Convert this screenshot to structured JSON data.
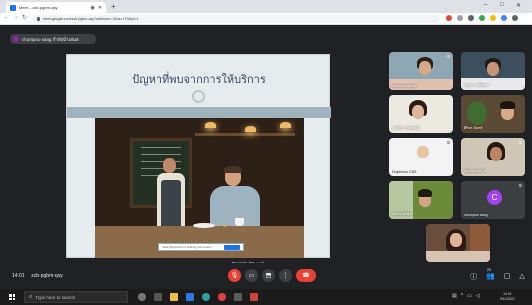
{
  "browser": {
    "tab_title": "Meet – zzb-pgbm-qsy",
    "url": "meet.google.com/zzb-pgbm-qsy?authuser=1&hs=179&pli=1"
  },
  "meet": {
    "presenting": "chompoo sang กำลังนำเสนอ",
    "slide_title": "ปัญหาที่พบจากการให้บริการ",
    "slide_caption": "Rentals (21 + s)",
    "present_pill_text": "meet.google.com is sharing your screen",
    "clock": "14:01",
    "meeting_code": "zzb-pgbm-qsy",
    "participant_count": "23"
  },
  "tiles": [
    {
      "name": "chompoo sang",
      "avatar_letter": ""
    },
    {
      "name": "ธนากร วงศ์ทอง",
      "avatar_letter": ""
    },
    {
      "name": "อาภิสรา รัตนพันธ์",
      "avatar_letter": ""
    },
    {
      "name": "ศิริพร จันทร์",
      "avatar_letter": ""
    },
    {
      "name": "Dolphinus CAS",
      "avatar_letter": ""
    },
    {
      "name": "ณัฐชนก สุขใจ",
      "avatar_letter": ""
    },
    {
      "name": "ปกรณ์ ศรีสุข",
      "avatar_letter": ""
    },
    {
      "name": "chompoo sang",
      "avatar_letter": "C"
    },
    {
      "name": "",
      "avatar_letter": ""
    }
  ],
  "taskbar": {
    "search_placeholder": "Type here to search",
    "time": "14:01",
    "date": "9/11/2021"
  },
  "colors": {
    "end_call": "#ea4335",
    "accent": "#1a73e8",
    "avatar": "#a142f4"
  }
}
